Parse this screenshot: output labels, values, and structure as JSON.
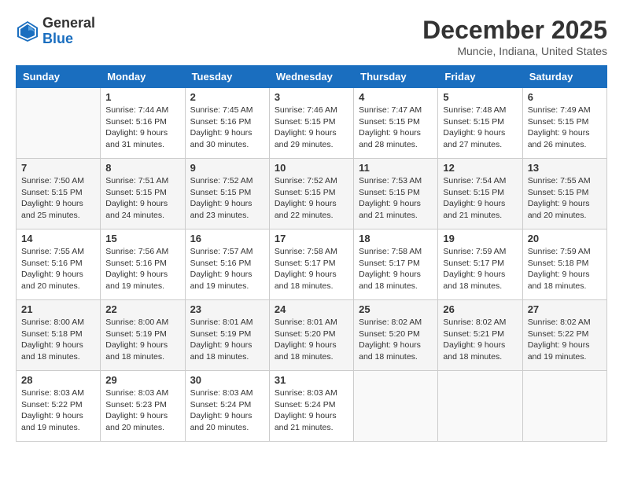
{
  "logo": {
    "general": "General",
    "blue": "Blue"
  },
  "header": {
    "month": "December 2025",
    "location": "Muncie, Indiana, United States"
  },
  "weekdays": [
    "Sunday",
    "Monday",
    "Tuesday",
    "Wednesday",
    "Thursday",
    "Friday",
    "Saturday"
  ],
  "weeks": [
    [
      {
        "day": "",
        "sunrise": "",
        "sunset": "",
        "daylight": ""
      },
      {
        "day": "1",
        "sunrise": "Sunrise: 7:44 AM",
        "sunset": "Sunset: 5:16 PM",
        "daylight": "Daylight: 9 hours and 31 minutes."
      },
      {
        "day": "2",
        "sunrise": "Sunrise: 7:45 AM",
        "sunset": "Sunset: 5:16 PM",
        "daylight": "Daylight: 9 hours and 30 minutes."
      },
      {
        "day": "3",
        "sunrise": "Sunrise: 7:46 AM",
        "sunset": "Sunset: 5:15 PM",
        "daylight": "Daylight: 9 hours and 29 minutes."
      },
      {
        "day": "4",
        "sunrise": "Sunrise: 7:47 AM",
        "sunset": "Sunset: 5:15 PM",
        "daylight": "Daylight: 9 hours and 28 minutes."
      },
      {
        "day": "5",
        "sunrise": "Sunrise: 7:48 AM",
        "sunset": "Sunset: 5:15 PM",
        "daylight": "Daylight: 9 hours and 27 minutes."
      },
      {
        "day": "6",
        "sunrise": "Sunrise: 7:49 AM",
        "sunset": "Sunset: 5:15 PM",
        "daylight": "Daylight: 9 hours and 26 minutes."
      }
    ],
    [
      {
        "day": "7",
        "sunrise": "Sunrise: 7:50 AM",
        "sunset": "Sunset: 5:15 PM",
        "daylight": "Daylight: 9 hours and 25 minutes."
      },
      {
        "day": "8",
        "sunrise": "Sunrise: 7:51 AM",
        "sunset": "Sunset: 5:15 PM",
        "daylight": "Daylight: 9 hours and 24 minutes."
      },
      {
        "day": "9",
        "sunrise": "Sunrise: 7:52 AM",
        "sunset": "Sunset: 5:15 PM",
        "daylight": "Daylight: 9 hours and 23 minutes."
      },
      {
        "day": "10",
        "sunrise": "Sunrise: 7:52 AM",
        "sunset": "Sunset: 5:15 PM",
        "daylight": "Daylight: 9 hours and 22 minutes."
      },
      {
        "day": "11",
        "sunrise": "Sunrise: 7:53 AM",
        "sunset": "Sunset: 5:15 PM",
        "daylight": "Daylight: 9 hours and 21 minutes."
      },
      {
        "day": "12",
        "sunrise": "Sunrise: 7:54 AM",
        "sunset": "Sunset: 5:15 PM",
        "daylight": "Daylight: 9 hours and 21 minutes."
      },
      {
        "day": "13",
        "sunrise": "Sunrise: 7:55 AM",
        "sunset": "Sunset: 5:15 PM",
        "daylight": "Daylight: 9 hours and 20 minutes."
      }
    ],
    [
      {
        "day": "14",
        "sunrise": "Sunrise: 7:55 AM",
        "sunset": "Sunset: 5:16 PM",
        "daylight": "Daylight: 9 hours and 20 minutes."
      },
      {
        "day": "15",
        "sunrise": "Sunrise: 7:56 AM",
        "sunset": "Sunset: 5:16 PM",
        "daylight": "Daylight: 9 hours and 19 minutes."
      },
      {
        "day": "16",
        "sunrise": "Sunrise: 7:57 AM",
        "sunset": "Sunset: 5:16 PM",
        "daylight": "Daylight: 9 hours and 19 minutes."
      },
      {
        "day": "17",
        "sunrise": "Sunrise: 7:58 AM",
        "sunset": "Sunset: 5:17 PM",
        "daylight": "Daylight: 9 hours and 18 minutes."
      },
      {
        "day": "18",
        "sunrise": "Sunrise: 7:58 AM",
        "sunset": "Sunset: 5:17 PM",
        "daylight": "Daylight: 9 hours and 18 minutes."
      },
      {
        "day": "19",
        "sunrise": "Sunrise: 7:59 AM",
        "sunset": "Sunset: 5:17 PM",
        "daylight": "Daylight: 9 hours and 18 minutes."
      },
      {
        "day": "20",
        "sunrise": "Sunrise: 7:59 AM",
        "sunset": "Sunset: 5:18 PM",
        "daylight": "Daylight: 9 hours and 18 minutes."
      }
    ],
    [
      {
        "day": "21",
        "sunrise": "Sunrise: 8:00 AM",
        "sunset": "Sunset: 5:18 PM",
        "daylight": "Daylight: 9 hours and 18 minutes."
      },
      {
        "day": "22",
        "sunrise": "Sunrise: 8:00 AM",
        "sunset": "Sunset: 5:19 PM",
        "daylight": "Daylight: 9 hours and 18 minutes."
      },
      {
        "day": "23",
        "sunrise": "Sunrise: 8:01 AM",
        "sunset": "Sunset: 5:19 PM",
        "daylight": "Daylight: 9 hours and 18 minutes."
      },
      {
        "day": "24",
        "sunrise": "Sunrise: 8:01 AM",
        "sunset": "Sunset: 5:20 PM",
        "daylight": "Daylight: 9 hours and 18 minutes."
      },
      {
        "day": "25",
        "sunrise": "Sunrise: 8:02 AM",
        "sunset": "Sunset: 5:20 PM",
        "daylight": "Daylight: 9 hours and 18 minutes."
      },
      {
        "day": "26",
        "sunrise": "Sunrise: 8:02 AM",
        "sunset": "Sunset: 5:21 PM",
        "daylight": "Daylight: 9 hours and 18 minutes."
      },
      {
        "day": "27",
        "sunrise": "Sunrise: 8:02 AM",
        "sunset": "Sunset: 5:22 PM",
        "daylight": "Daylight: 9 hours and 19 minutes."
      }
    ],
    [
      {
        "day": "28",
        "sunrise": "Sunrise: 8:03 AM",
        "sunset": "Sunset: 5:22 PM",
        "daylight": "Daylight: 9 hours and 19 minutes."
      },
      {
        "day": "29",
        "sunrise": "Sunrise: 8:03 AM",
        "sunset": "Sunset: 5:23 PM",
        "daylight": "Daylight: 9 hours and 20 minutes."
      },
      {
        "day": "30",
        "sunrise": "Sunrise: 8:03 AM",
        "sunset": "Sunset: 5:24 PM",
        "daylight": "Daylight: 9 hours and 20 minutes."
      },
      {
        "day": "31",
        "sunrise": "Sunrise: 8:03 AM",
        "sunset": "Sunset: 5:24 PM",
        "daylight": "Daylight: 9 hours and 21 minutes."
      },
      {
        "day": "",
        "sunrise": "",
        "sunset": "",
        "daylight": ""
      },
      {
        "day": "",
        "sunrise": "",
        "sunset": "",
        "daylight": ""
      },
      {
        "day": "",
        "sunrise": "",
        "sunset": "",
        "daylight": ""
      }
    ]
  ]
}
